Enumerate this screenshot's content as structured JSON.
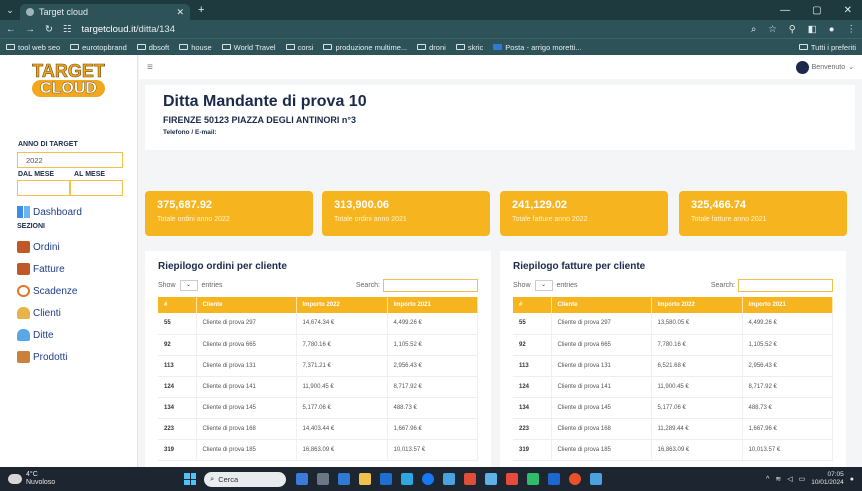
{
  "browser": {
    "tab_title": "Target cloud",
    "url_host": "targetcloud.it",
    "url_path": "/ditta/134",
    "bookmarks": [
      "tool web seo",
      "eurotopbrand",
      "dbsoft",
      "house",
      "World Travel",
      "corsi",
      "produzione multime...",
      "droni",
      "skric",
      "Posta - arrigo moretti..."
    ],
    "all_bookmarks": "Tutti i preferiti"
  },
  "sidebar": {
    "logo_line1": "TARGET",
    "logo_line2": "CLOUD",
    "anno_label": "ANNO DI TARGET",
    "anno_value": "2022",
    "dal_mese": "DAL MESE",
    "al_mese": "AL MESE",
    "sezioni": "SEZIONI",
    "items": [
      {
        "label": "Dashboard",
        "icon": "dashboard-icon",
        "color": "#3a8ee6"
      },
      {
        "label": "Ordini",
        "icon": "orders-icon",
        "color": "#c0582a"
      },
      {
        "label": "Fatture",
        "icon": "invoices-icon",
        "color": "#c0582a"
      },
      {
        "label": "Scadenze",
        "icon": "clock-icon",
        "color": "#e0762a"
      },
      {
        "label": "Clienti",
        "icon": "clients-icon",
        "color": "#e8b34a"
      },
      {
        "label": "Ditte",
        "icon": "company-icon",
        "color": "#5aa7e6"
      },
      {
        "label": "Prodotti",
        "icon": "box-icon",
        "color": "#c9823a"
      }
    ]
  },
  "header": {
    "menu_icon": "hamburger-icon",
    "user_label": "Benvenuto"
  },
  "ditta": {
    "title": "Ditta Mandante di prova 10",
    "address": "FIRENZE 50123 PIAZZA DEGLI ANTINORI n°3",
    "contact": "Telefono / E-mail:"
  },
  "kpis": [
    {
      "value": "375,687.92",
      "label": "Totale ordini anno 2022"
    },
    {
      "value": "313,900.06",
      "label": "Totale ordini anno 2021"
    },
    {
      "value": "241,129.02",
      "label": "Totale fatture anno 2022"
    },
    {
      "value": "325,466.74",
      "label": "Totale fatture anno 2021"
    }
  ],
  "ordini": {
    "title": "Riepilogo ordini per cliente",
    "show": "Show",
    "entries": "entries",
    "search": "Search:",
    "columns": [
      "#",
      "Cliente",
      "Importo 2022",
      "Importo 2021"
    ],
    "rows": [
      [
        "55",
        "Cliente di prova 297",
        "14,674.34 €",
        "4,499.26 €"
      ],
      [
        "92",
        "Cliente di prova 665",
        "7,780.16 €",
        "1,105.52 €"
      ],
      [
        "113",
        "Cliente di prova 131",
        "7,371.21 €",
        "2,956.43 €"
      ],
      [
        "124",
        "Cliente di prova 141",
        "11,900.45 €",
        "8,717.92 €"
      ],
      [
        "134",
        "Cliente di prova 145",
        "5,177.06 €",
        "488.73 €"
      ],
      [
        "223",
        "Cliente di prova 168",
        "14,403.44 €",
        "1,667.96 €"
      ],
      [
        "319",
        "Cliente di prova 185",
        "16,863.09 €",
        "10,013.57 €"
      ]
    ]
  },
  "fatture": {
    "title": "Riepilogo fatture per cliente",
    "show": "Show",
    "entries": "entries",
    "search": "Search:",
    "columns": [
      "#",
      "Cliente",
      "Importo 2022",
      "Importo 2021"
    ],
    "rows": [
      [
        "55",
        "Cliente di prova 297",
        "13,580.05 €",
        "4,499.26 €"
      ],
      [
        "92",
        "Cliente di prova 665",
        "7,780.16 €",
        "1,105.52 €"
      ],
      [
        "113",
        "Cliente di prova 131",
        "6,521.68 €",
        "2,956.43 €"
      ],
      [
        "124",
        "Cliente di prova 141",
        "11,900.45 €",
        "8,717.92 €"
      ],
      [
        "134",
        "Cliente di prova 145",
        "5,177.06 €",
        "488.73 €"
      ],
      [
        "223",
        "Cliente di prova 168",
        "11,289.44 €",
        "1,667.96 €"
      ],
      [
        "319",
        "Cliente di prova 185",
        "16,863.09 €",
        "10,013.57 €"
      ]
    ]
  },
  "taskbar": {
    "temp": "4°C",
    "weather": "Nuvoloso",
    "search": "Cerca",
    "time": "07:05",
    "date": "10/01/2024"
  }
}
